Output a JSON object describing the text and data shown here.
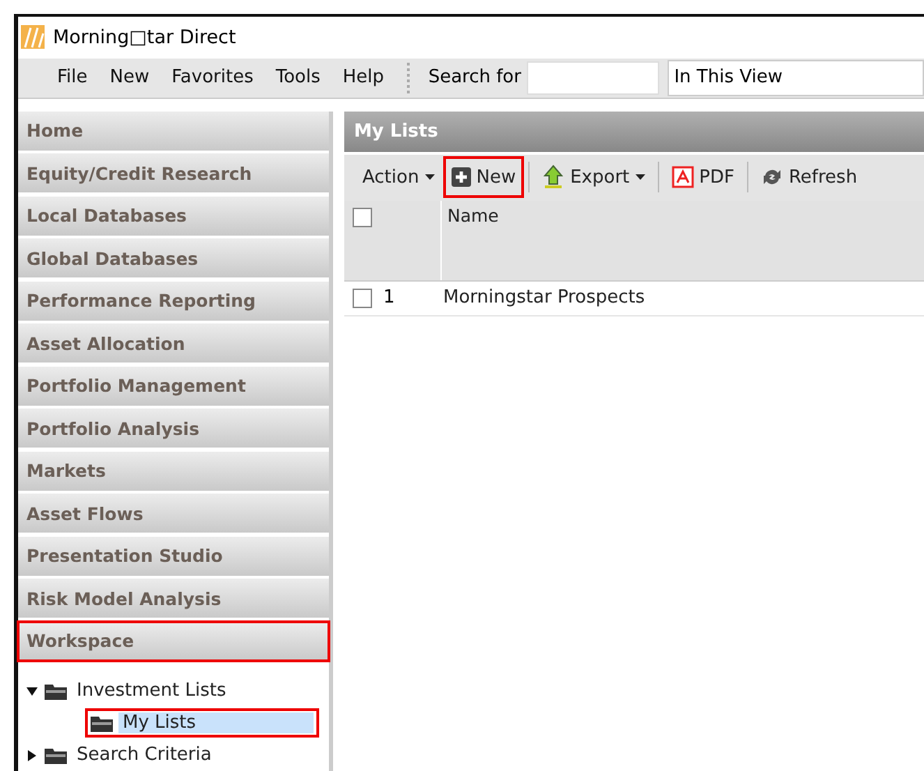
{
  "window": {
    "title": "Morning□tar Direct"
  },
  "menu": [
    {
      "label": "File"
    },
    {
      "label": "New"
    },
    {
      "label": "Favorites"
    },
    {
      "label": "Tools"
    },
    {
      "label": "Help"
    }
  ],
  "search": {
    "label": "Search for",
    "scope": "In This View"
  },
  "sidebar": {
    "items": [
      {
        "label": "Home",
        "highlighted": false
      },
      {
        "label": "Equity/Credit Research",
        "highlighted": false
      },
      {
        "label": "Local Databases",
        "highlighted": false
      },
      {
        "label": "Global Databases",
        "highlighted": false
      },
      {
        "label": "Performance Reporting",
        "highlighted": false
      },
      {
        "label": "Asset Allocation",
        "highlighted": false
      },
      {
        "label": "Portfolio Management",
        "highlighted": false
      },
      {
        "label": "Portfolio Analysis",
        "highlighted": false
      },
      {
        "label": "Markets",
        "highlighted": false
      },
      {
        "label": "Asset Flows",
        "highlighted": false
      },
      {
        "label": "Presentation Studio",
        "highlighted": false
      },
      {
        "label": "Risk Model Analysis",
        "highlighted": false
      },
      {
        "label": "Workspace",
        "highlighted": true
      }
    ],
    "tree": [
      {
        "label": "Investment Lists",
        "expanded": true,
        "selected": false,
        "highlighted": false,
        "children": [
          {
            "label": "My Lists",
            "selected": true,
            "highlighted": true
          }
        ]
      },
      {
        "label": "Search Criteria",
        "expanded": false,
        "selected": false,
        "highlighted": false
      }
    ]
  },
  "panel": {
    "title": "My Lists",
    "toolbar": [
      {
        "kind": "dropdown",
        "label": "Action",
        "highlighted": false
      },
      {
        "kind": "new",
        "label": "New",
        "highlighted": true
      },
      {
        "kind": "export",
        "label": "Export",
        "highlighted": false
      },
      {
        "kind": "pdf",
        "label": "PDF",
        "highlighted": false
      },
      {
        "kind": "refresh",
        "label": "Refresh",
        "highlighted": false
      }
    ],
    "table": {
      "columns": [
        "Name"
      ],
      "header_checked": false,
      "rows": [
        {
          "number": "1",
          "name": "Morningstar Prospects",
          "checked": false
        }
      ]
    }
  }
}
